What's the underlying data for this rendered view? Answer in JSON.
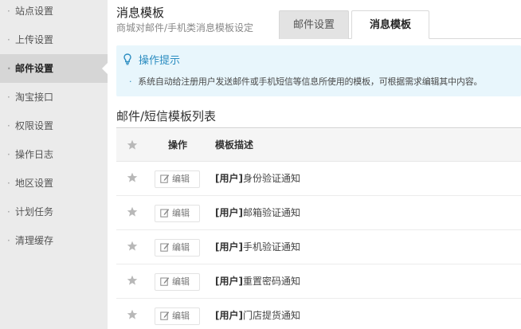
{
  "sidebar": {
    "items": [
      {
        "label": "站点设置"
      },
      {
        "label": "上传设置"
      },
      {
        "label": "邮件设置"
      },
      {
        "label": "淘宝接口"
      },
      {
        "label": "权限设置"
      },
      {
        "label": "操作日志"
      },
      {
        "label": "地区设置"
      },
      {
        "label": "计划任务"
      },
      {
        "label": "清理缓存"
      }
    ],
    "active_label": "邮件设置"
  },
  "header": {
    "title": "消息模板",
    "subtitle": "商城对邮件/手机类消息模板设定",
    "tabs": [
      {
        "label": "邮件设置"
      },
      {
        "label": "消息模板"
      }
    ],
    "active_tab": "消息模板"
  },
  "tip": {
    "title": "操作提示",
    "text": "系统自动给注册用户发送邮件或手机短信等信息所使用的模板，可根据需求编辑其中内容。",
    "bullet": "·"
  },
  "list": {
    "title": "邮件/短信模板列表",
    "columns": {
      "action": "操作",
      "description": "模板描述"
    },
    "edit_label": "编辑",
    "rows": [
      {
        "tag": "[用户]",
        "name": "身份验证通知"
      },
      {
        "tag": "[用户]",
        "name": "邮箱验证通知"
      },
      {
        "tag": "[用户]",
        "name": "手机验证通知"
      },
      {
        "tag": "[用户]",
        "name": "重置密码通知"
      },
      {
        "tag": "[用户]",
        "name": "门店提货通知"
      }
    ]
  },
  "colors": {
    "accent": "#2a8cc0",
    "tip_bg": "#e8f6fc",
    "sidebar_bg": "#ebebeb",
    "sidebar_active_bg": "#d6d6d6"
  }
}
